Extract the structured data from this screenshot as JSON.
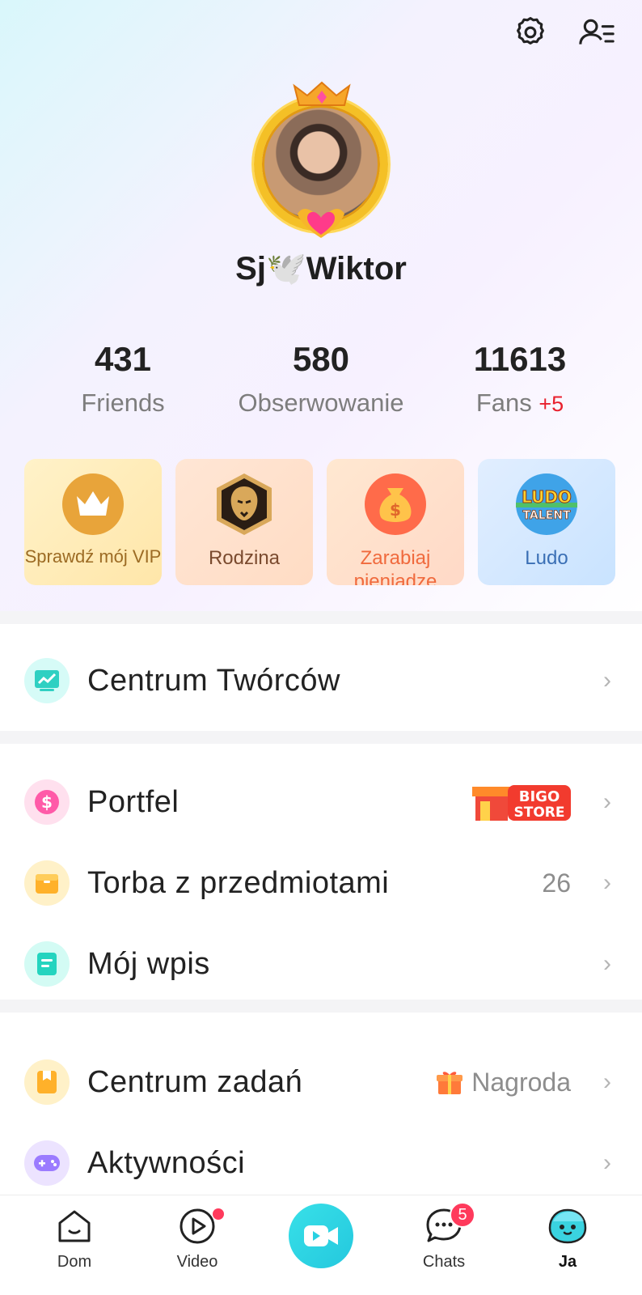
{
  "profile": {
    "username": "Sj🕊️Wiktor"
  },
  "stats": [
    {
      "value": "431",
      "label": "Friends",
      "extra": ""
    },
    {
      "value": "580",
      "label": "Obserwowanie",
      "extra": ""
    },
    {
      "value": "11613",
      "label": "Fans",
      "extra": "+5"
    }
  ],
  "cards": [
    {
      "label": "Sprawdź mój VIP",
      "icon": "crown-icon"
    },
    {
      "label": "Rodzina",
      "icon": "lion-icon"
    },
    {
      "label": "Zarabiaj pieniądze",
      "icon": "money-bag-icon"
    },
    {
      "label": "Ludo",
      "icon": "ludo-talent-icon",
      "icon_text_top": "LUDO",
      "icon_text_bottom": "TALENT"
    }
  ],
  "menu": {
    "creator_center": "Centrum Twórców",
    "wallet": "Portfel",
    "wallet_badge_top": "BIGO",
    "wallet_badge_bottom": "STORE",
    "item_bag": "Torba z przedmiotami",
    "item_bag_count": "26",
    "my_post": "Mój wpis",
    "task_center": "Centrum zadań",
    "task_reward": "Nagroda",
    "activities": "Aktywności"
  },
  "nav": {
    "home": "Dom",
    "video": "Video",
    "chats": "Chats",
    "chats_badge": "5",
    "me": "Ja"
  },
  "colors": {
    "accent": "#28d1e2",
    "badge": "#ff3a5c",
    "fans_plus": "#e8202d"
  }
}
